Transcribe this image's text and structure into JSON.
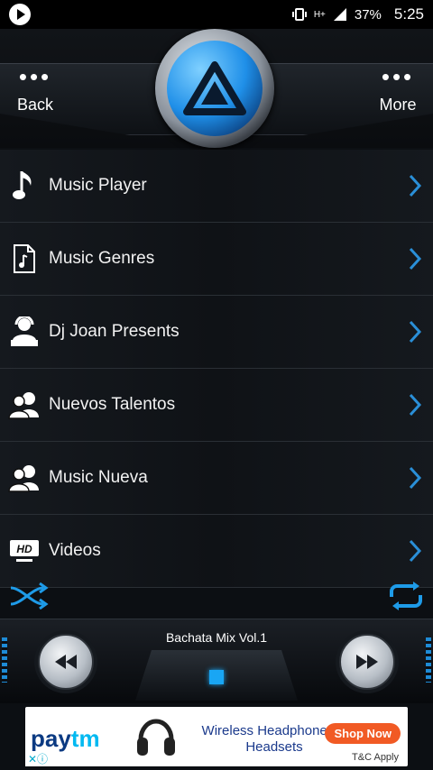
{
  "status_bar": {
    "network": "H+",
    "battery": "37%",
    "time": "5:25"
  },
  "header": {
    "back_label": "Back",
    "more_label": "More"
  },
  "menu": {
    "items": [
      {
        "label": "Music Player",
        "icon": "music-note-icon"
      },
      {
        "label": "Music Genres",
        "icon": "music-file-icon"
      },
      {
        "label": "Dj Joan Presents",
        "icon": "dj-icon"
      },
      {
        "label": "Nuevos Talentos",
        "icon": "users-icon"
      },
      {
        "label": "Music Nueva",
        "icon": "users-icon"
      },
      {
        "label": "Videos",
        "icon": "hd-icon"
      }
    ]
  },
  "player": {
    "track_title": "Bachata Mix Vol.1"
  },
  "ad": {
    "brand": "Paytm",
    "headline": "Wireless Headphones & Headsets",
    "cta": "Shop Now",
    "tc": "T&C Apply"
  },
  "colors": {
    "accent": "#19a6f4",
    "background": "#0c0f13"
  }
}
